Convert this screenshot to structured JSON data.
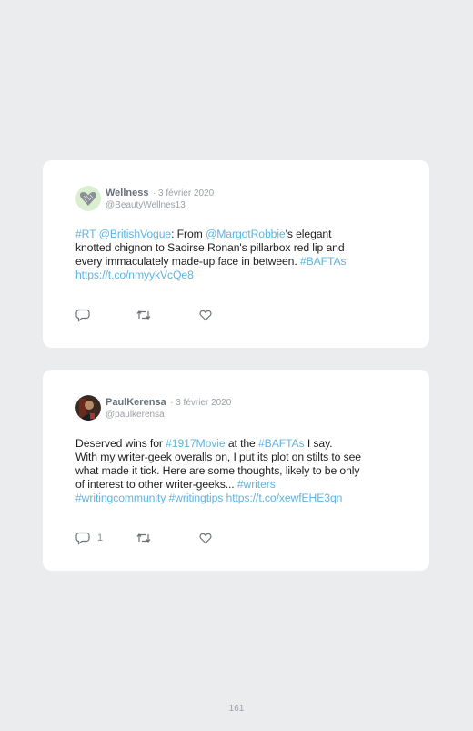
{
  "tweets": [
    {
      "name": "Wellness",
      "date": "· 3 février 2020",
      "handle": "@BeautyWellnes13",
      "avatar": "heart-avatar",
      "text": [
        {
          "t": "#RT @BritishVogue",
          "link": true
        },
        {
          "t": ": From ",
          "link": false
        },
        {
          "t": "@MargotRobbie",
          "link": true
        },
        {
          "t": "'s elegant\nknotted chignon to Saoirse Ronan's pillarbox red lip and\nevery immaculately made-up face in between. ",
          "link": false
        },
        {
          "t": "#BAFTAs\nhttps://t.co/nmyykVcQe8",
          "link": true
        }
      ],
      "reply_count": ""
    },
    {
      "name": "PaulKerensa",
      "date": "· 3 février 2020",
      "handle": "@paulkerensa",
      "avatar": "photo-avatar",
      "text": [
        {
          "t": "Deserved wins for ",
          "link": false
        },
        {
          "t": "#1917Movie",
          "link": true
        },
        {
          "t": " at the ",
          "link": false
        },
        {
          "t": "#BAFTAs",
          "link": true
        },
        {
          "t": " I say.\nWith my writer-geek overalls on, I put its plot on stilts to see\nwhat made it tick. Here are some thoughts, likely to be only\nof interest to other writer-geeks... ",
          "link": false
        },
        {
          "t": "#writers\n#writingcommunity #writingtips https://t.co/xewfEHE3qn",
          "link": true
        }
      ],
      "reply_count": "1"
    }
  ],
  "page_number": "161",
  "colors": {
    "link": "#5fb4df",
    "background": "#ebeced",
    "card": "#ffffff"
  },
  "icons": [
    "reply-icon",
    "retweet-icon",
    "like-icon"
  ]
}
